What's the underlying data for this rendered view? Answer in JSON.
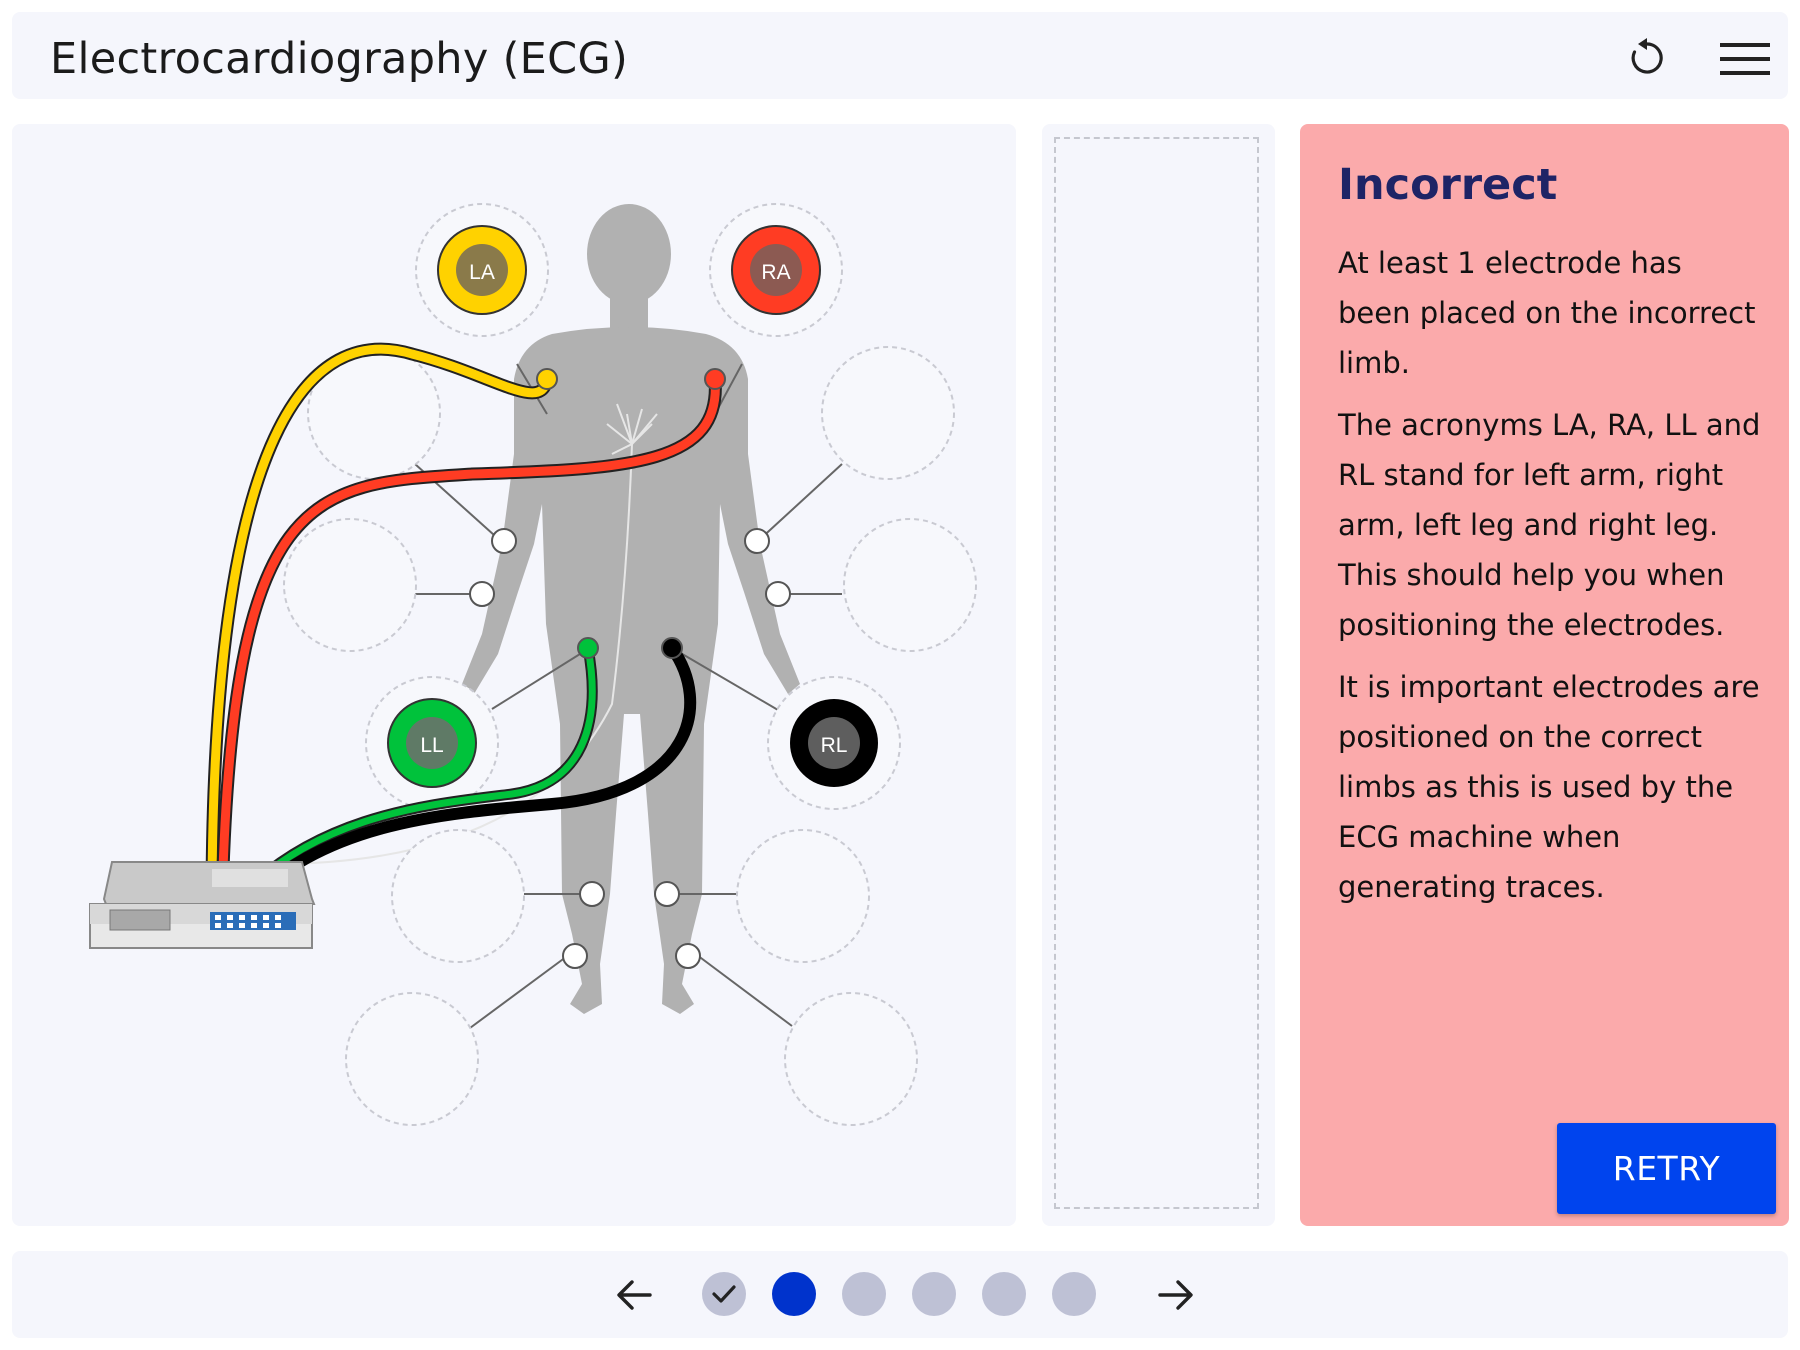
{
  "header": {
    "title": "Electrocardiography (ECG)"
  },
  "electrodes": [
    {
      "label": "LA",
      "color": "#ffd200",
      "cable": "yellow"
    },
    {
      "label": "RA",
      "color": "#ff3c23",
      "cable": "red"
    },
    {
      "label": "LL",
      "color": "#00c23b",
      "cable": "green"
    },
    {
      "label": "RL",
      "color": "#000000",
      "cable": "black"
    }
  ],
  "feedback": {
    "title": "Incorrect",
    "paragraphs": [
      "At least 1 electrode has been placed on the incorrect limb.",
      "The acronyms LA, RA, LL and RL stand for left arm, right arm, left leg and right leg. This should help you when positioning the electrodes.",
      "It is important electrodes are positioned on the correct limbs as this is used by the ECG machine when generating traces."
    ],
    "retry_label": "RETRY",
    "background": "#fbaaab"
  },
  "pagination": {
    "total": 6,
    "current": 2,
    "completed": [
      1
    ]
  },
  "colors": {
    "accent": "#0044ee",
    "dot_active": "#0033cc",
    "dot_inactive": "#bec1d5"
  }
}
